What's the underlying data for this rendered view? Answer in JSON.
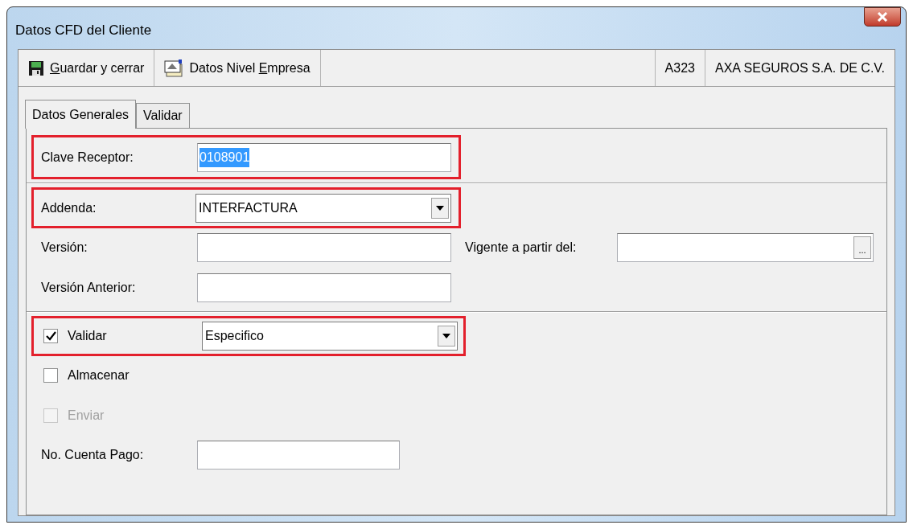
{
  "window": {
    "title": "Datos CFD del Cliente"
  },
  "toolbar": {
    "buttons": [
      {
        "kind": "save",
        "key": "G",
        "after": "uardar y cerrar"
      },
      {
        "kind": "company",
        "before": "Datos Nivel ",
        "key": "E",
        "after": "mpresa"
      }
    ],
    "code": "A323",
    "company": "AXA SEGUROS S.A. DE C.V."
  },
  "tabs": [
    {
      "label": "Datos Generales",
      "selected": true
    },
    {
      "label": "Validar",
      "selected": false
    }
  ],
  "form": {
    "clave_receptor": {
      "label": "Clave Receptor:",
      "value": "0108901",
      "text_selected": true,
      "highlighted": true
    },
    "addenda": {
      "label": "Addenda:",
      "value": "INTERFACTURA",
      "highlighted": true
    },
    "version": {
      "label": "Versión:"
    },
    "vigente": {
      "label": "Vigente a partir del:",
      "button": "..."
    },
    "version_anterior": {
      "label": "Versión Anterior:"
    },
    "validar": {
      "label": "Validar",
      "checked": true,
      "disabled": false,
      "value": "Especifico",
      "highlighted": true
    },
    "almacenar": {
      "label": "Almacenar",
      "checked": false,
      "disabled": false
    },
    "enviar": {
      "label": "Enviar",
      "checked": false,
      "disabled": true
    },
    "no_cuenta_pago": {
      "label": "No. Cuenta Pago:"
    }
  }
}
